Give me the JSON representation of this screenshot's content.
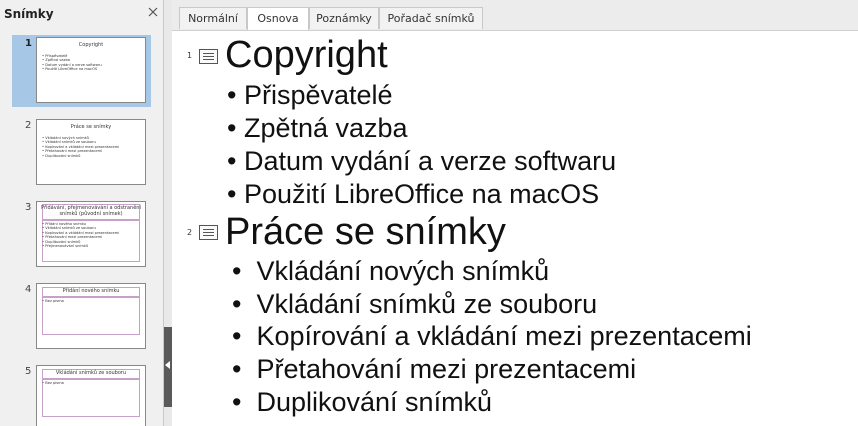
{
  "slides_panel": {
    "title": "Snímky",
    "slides": [
      {
        "number": "1",
        "title": "Copyright",
        "lines": [
          "• Přispěvatelé",
          "• Zpětná vazba",
          "• Datum vydání a verze softwaru",
          "• Použití LibreOffice na macOS"
        ]
      },
      {
        "number": "2",
        "title": "Práce se snímky",
        "lines": [
          "• Vkládání nových snímků",
          "• Vkládání snímků ze souboru",
          "• Kopírování a vkládání mezi prezentacemi",
          "• Přetahování mezi prezentacemi",
          "• Duplikování snímků"
        ]
      },
      {
        "number": "3",
        "title": "Přidávání, přejmenovávání a odstranění snímků (původní snímek)",
        "lines": [
          "• Přidání nového snímku",
          "• Vkládání snímků ze souboru",
          "• Kopírování a vkládání mezi prezentacemi",
          "• Přetahování mezi prezentacemi",
          "• Duplikování snímků",
          "• Přejmenovávání snímků"
        ]
      },
      {
        "number": "4",
        "title": "Přidání nového snímku",
        "lines": [
          "• Bez písma"
        ]
      },
      {
        "number": "5",
        "title": "Vkládání snímků ze souboru",
        "lines": [
          "• Bez písma"
        ]
      }
    ]
  },
  "tabs": [
    {
      "label": "Normální"
    },
    {
      "label": "Osnova"
    },
    {
      "label": "Poznámky"
    },
    {
      "label": "Pořadač snímků"
    }
  ],
  "active_tab": "Osnova",
  "outline": [
    {
      "number": "1",
      "title": "Copyright",
      "bullets": [
        "Přispěvatelé",
        "Zpětná vazba",
        "Datum vydání a verze softwaru",
        "Použití LibreOffice na macOS"
      ]
    },
    {
      "number": "2",
      "title": "Práce se snímky",
      "bullets": [
        "Vkládání nových snímků",
        "Vkládání snímků ze souboru",
        "Kopírování a vkládání mezi prezentacemi",
        "Přetahování mezi prezentacemi",
        "Duplikování snímků"
      ]
    }
  ],
  "colors": {
    "selection": "#a7c7e7",
    "panel_bg": "#f0f0f0",
    "splitter_handle": "#5a5a5a"
  }
}
